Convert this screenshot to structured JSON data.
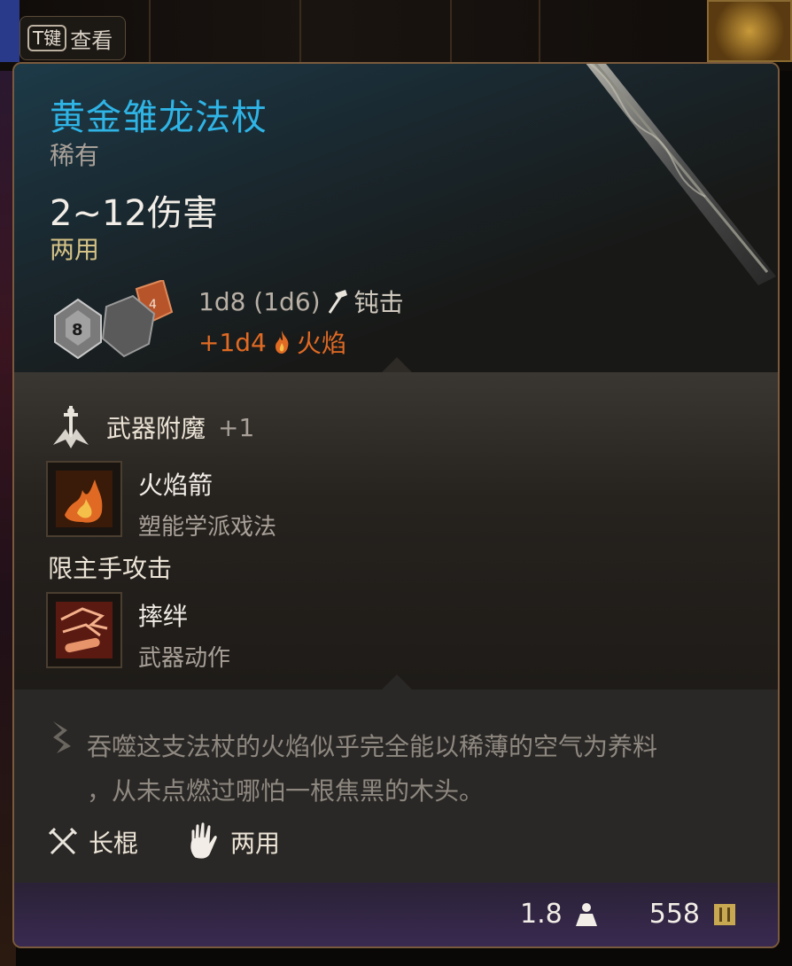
{
  "key_hint": {
    "key": "T键",
    "label": "查看"
  },
  "item": {
    "name": "黄金雏龙法杖",
    "rarity": "稀有",
    "damage": "2~12伤害",
    "handedness": "两用",
    "damage_dice": "1d8 (1d6)",
    "damage_type": "钝击",
    "bonus_dice": "+1d4",
    "bonus_type": "火焰",
    "dice_faces": [
      "8",
      "4"
    ]
  },
  "enchantment": {
    "label": "武器附魔",
    "bonus": "+1"
  },
  "spells": [
    {
      "name": "火焰箭",
      "school": "塑能学派戏法"
    }
  ],
  "restriction": "限主手攻击",
  "actions": [
    {
      "name": "摔绊",
      "type": "武器动作"
    }
  ],
  "description": {
    "line1": "吞噬这支法杖的火焰似乎完全能以稀薄的空气为养料",
    "line2": "，从未点燃过哪怕一根焦黑的木头。"
  },
  "properties": [
    {
      "label": "长棍",
      "icon": "crossed-staves-icon"
    },
    {
      "label": "两用",
      "icon": "hand-icon"
    }
  ],
  "stats": {
    "weight": "1.8",
    "value": "558"
  },
  "colors": {
    "title": "#2fb4e6",
    "fire": "#e06a24",
    "handed": "#d4c286",
    "border": "#7a5a3c"
  }
}
